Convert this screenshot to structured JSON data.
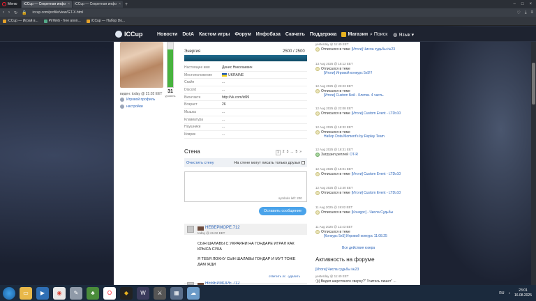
{
  "browser": {
    "menu_label": "Меню",
    "tabs": [
      {
        "title": "iCCup — Секретная инфо",
        "active": true
      },
      {
        "title": "iCCup — Секретная инфо",
        "active": false
      }
    ],
    "url": "iccup.com/profile/view/GT-X.html",
    "bookmarks": [
      "iCCup — Играй в...",
      "PirWeb - free anon...",
      "iCCup — Набор Do..."
    ]
  },
  "site": {
    "logo": "ICCup",
    "menu": [
      "Новости",
      "DotA",
      "Кастом игры",
      "Форум",
      "Инфобаза",
      "Скачать",
      "Поддержка",
      "Магазин"
    ],
    "search": "Поиск",
    "lang": "Язык"
  },
  "profile": {
    "level": "31",
    "level_label": "уровень",
    "seen": "виден: today @ 21:02 EET",
    "links": [
      "Игровой профиль",
      "настройки"
    ],
    "energy_label": "Энергия",
    "energy_value": "2500 / 2500",
    "fields": [
      {
        "key": "Настоящее имя",
        "value": "Денис Николаевич"
      },
      {
        "key": "Местоположение",
        "value": "UKRAINE"
      },
      {
        "key": "Скайп",
        "value": "..."
      },
      {
        "key": "Discord",
        "value": "..."
      },
      {
        "key": "Вконтакте",
        "value": "http://vk.com/id99"
      },
      {
        "key": "Возраст",
        "value": "26"
      },
      {
        "key": "Мышка",
        "value": "..."
      },
      {
        "key": "Клавиатура",
        "value": "..."
      },
      {
        "key": "Наушники",
        "value": "..."
      },
      {
        "key": "Коврик",
        "value": "..."
      }
    ]
  },
  "wall": {
    "title": "Стена",
    "pages": [
      "1",
      "2",
      "3",
      "...",
      "5",
      "»"
    ],
    "clear": "Очистить стену",
    "permission": "На стене могут писать только друзья",
    "symbols_left": "symbols left: 200",
    "post_button": "Оставить сообщение",
    "comments": [
      {
        "author": "НЕВЕРМОРЕ.712",
        "date": "today @ 21:02 EET",
        "lines": [
          "СЫН ШАЛАВЫ С УКРАИНИ НА ГОНДАРЕ ИГРАЛ КАК КРЫСА СУКА",
          "Я ТЕБЯ ЛОХНУ СЫН ШАЛАВЫ ГОНДАР И МУТ ТОЖЕ ДАМ ЖДИ"
        ],
        "actions": "ответить лс · удалить"
      },
      {
        "author": "НЕВЕРМОРЕ.712"
      }
    ]
  },
  "activity": {
    "events": [
      {
        "date": "yesterday @ 11:40 EET",
        "action": "Отписался в теме",
        "link": "[Итоги] Числа судьбы №23",
        "sub": ""
      },
      {
        "date": "13 Aug 2025 @ 15:12 EET",
        "action": "Отписался в теме",
        "link": "",
        "sub": "[Итоги] Игровой конкурс 5x5!!!"
      },
      {
        "date": "12 Aug 2025 @ 23:23 EET",
        "action": "Отписался в теме",
        "link": "",
        "sub": "[Итоги] Custom Бой - Клетки. 4 часть."
      },
      {
        "date": "12 Aug 2025 @ 22:08 EET",
        "action": "Отписался в теме",
        "link": "[Итоги] Custom Event - LTDx10",
        "sub": ""
      },
      {
        "date": "12 Aug 2025 @ 18:32 EET",
        "action": "Отписался в теме",
        "link": "",
        "sub": "Набор Dota Moment's by Replay Team"
      },
      {
        "date": "12 Aug 2025 @ 18:31 EET",
        "action": "Загрузил реплей",
        "link": "OT-R",
        "sub": "",
        "green": true
      },
      {
        "date": "12 Aug 2025 @ 15:01 EET",
        "action": "Отписался в теме",
        "link": "[Итоги] Custom Event - LTDx10",
        "sub": ""
      },
      {
        "date": "12 Aug 2025 @ 13:40 EET",
        "action": "Отписался в теме",
        "link": "[Итоги] Custom Event - LTDx10",
        "sub": ""
      },
      {
        "date": "11 Aug 2025 @ 19:02 EET",
        "action": "Отписался в теме",
        "link": "[Конкурс] - Числа Судьбы",
        "sub": ""
      },
      {
        "date": "11 Aug 2025 @ 12:43 EET",
        "action": "Отписался в теме",
        "link": "",
        "sub": "[Конкурс 5x5] Игровой конкурс 11.08.25"
      }
    ],
    "all": "Все действия юзера"
  },
  "forum": {
    "title": "Активность на форуме",
    "link": "[Итоги] Числа судьбы №23",
    "date": "yesterday @ 11:40 EET",
    "text": ":))) Видел шерстяного сверху?\" Учитесь пишет\" ..."
  },
  "taskbar": {
    "lang": "RU",
    "time": "23:01",
    "date": "16.08.2025"
  }
}
